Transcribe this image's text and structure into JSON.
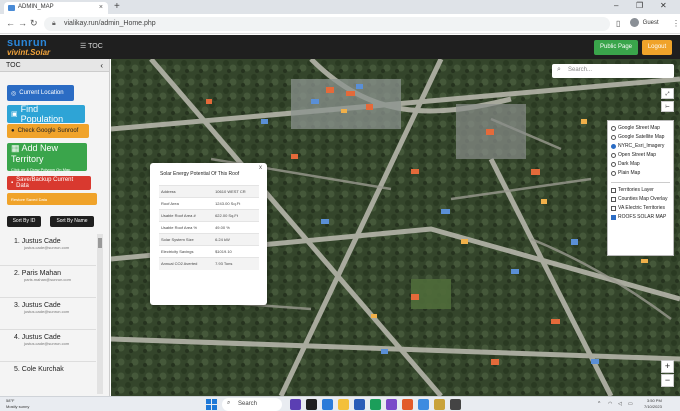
{
  "browser": {
    "tab_title": "ADMIN_MAP",
    "new_tab": "+",
    "url": "vialikay.run/admin_Home.php",
    "profile": "Guest",
    "window_controls": [
      "–",
      "❐",
      "✕"
    ]
  },
  "header": {
    "logo_top": "sunrun",
    "logo_bottom": "vivint.Solar",
    "toc_toggle": "TOC",
    "public_page": "Public Page",
    "logout": "Logout"
  },
  "sidebar": {
    "title": "TOC",
    "buttons": {
      "current_location": "Current Location",
      "find_population": "Find Population",
      "check_google": "Check Google Sunroof",
      "add_territory": "Add New Territory",
      "add_territory_sub": "Click on & Draw Polygon On Map",
      "save_backup": "Save/Backup Current Data",
      "restore_saved": "Restore Saved Data"
    },
    "sort_by_id": "Sort By ID",
    "sort_by_name": "Sort By Name",
    "users": [
      {
        "name": "1. Justus Cade",
        "email": "justus.cade@sunrun.com"
      },
      {
        "name": "2. Paris Mahan",
        "email": "paris.mahan@sunrun.com"
      },
      {
        "name": "3. Justus Cade",
        "email": "justus.cade@sunrun.com"
      },
      {
        "name": "4. Justus Cade",
        "email": "justus.cade@sunrun.com"
      },
      {
        "name": "5. Cole Kurchak",
        "email": ""
      }
    ]
  },
  "map": {
    "search_placeholder": "Search...",
    "layers": {
      "base": [
        {
          "label": "Google Street Map",
          "selected": false
        },
        {
          "label": "Google Satellite Map",
          "selected": false
        },
        {
          "label": "NYRC_Esri_Imagery",
          "selected": true
        },
        {
          "label": "Open Street Map",
          "selected": false
        },
        {
          "label": "Dark Map",
          "selected": false
        },
        {
          "label": "Plain Map",
          "selected": false
        }
      ],
      "overlays": [
        {
          "label": "Territories Layer",
          "checked": false
        },
        {
          "label": "Counties Map Overlay",
          "checked": false
        },
        {
          "label": "VA Electric Territories",
          "checked": false
        },
        {
          "label": "ROOFS SOLAR MAP",
          "checked": true
        }
      ]
    },
    "popup": {
      "title": "Solar Energy  Potential Of This Roof",
      "close": "x",
      "rows": [
        {
          "label": "Address",
          "value": "10610 WEST CR"
        },
        {
          "label": "Roof Area",
          "value": "1243.00 Sq.Ft"
        },
        {
          "label": "Usable Roof Area #",
          "value": "622.00 Sq.Ft"
        },
        {
          "label": "Usable Roof Area %",
          "value": "49.00 %"
        },
        {
          "label": "Solar System Size",
          "value": "6.24 kW"
        },
        {
          "label": "Electricity Savings",
          "value": "$1019.10"
        },
        {
          "label": "Annual CO2 Averted",
          "value": "7.93 Tons"
        }
      ]
    },
    "zoom_in": "+",
    "zoom_out": "−"
  },
  "taskbar": {
    "weather_temp": "58°F",
    "weather_desc": "Mostly sunny",
    "search_label": "Search",
    "time": "3:50 PM",
    "date": "7/10/2023"
  },
  "colors": {
    "sunrun_blue": "#2a86d9",
    "vivint_orange": "#f2a33a",
    "public_green": "#3aa54b",
    "logout_orange": "#f0a32a",
    "backup_red": "#d9392f"
  }
}
